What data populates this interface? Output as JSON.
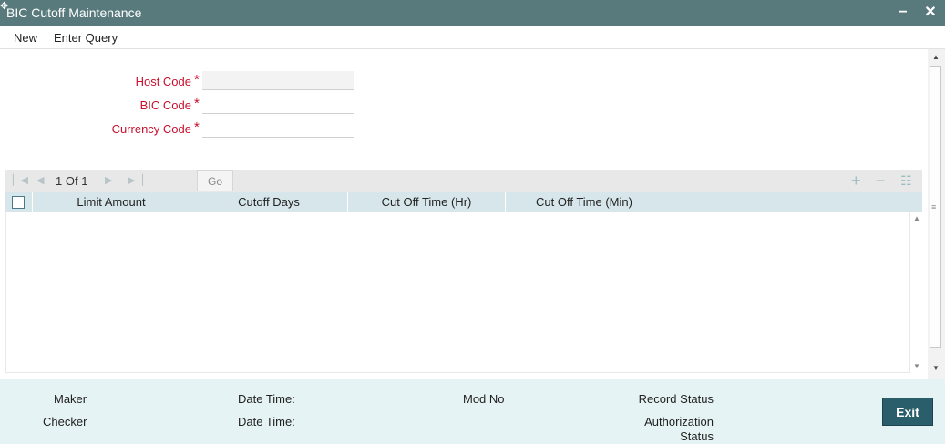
{
  "window": {
    "title": "BIC Cutoff Maintenance",
    "minimize_label": "−",
    "close_label": "✕"
  },
  "menu": {
    "new_label": "New",
    "enter_query_label": "Enter Query"
  },
  "form": {
    "host_code": {
      "label": "Host Code",
      "required_mark": "*",
      "value": ""
    },
    "bic_code": {
      "label": "BIC Code",
      "required_mark": "*",
      "value": ""
    },
    "currency_code": {
      "label": "Currency Code",
      "required_mark": "*",
      "value": ""
    }
  },
  "grid": {
    "pagination": {
      "current": "1",
      "of_label": "Of",
      "total": "1"
    },
    "go_label": "Go",
    "columns": [
      "Limit Amount",
      "Cutoff Days",
      "Cut Off Time (Hr)",
      "Cut Off Time (Min)"
    ],
    "rows": []
  },
  "footer": {
    "maker_label": "Maker",
    "checker_label": "Checker",
    "date_time_label": "Date Time:",
    "mod_no_label": "Mod No",
    "record_status_label": "Record Status",
    "authorization_status_line1": "Authorization",
    "authorization_status_line2": "Status",
    "exit_label": "Exit"
  },
  "icons": {
    "first": "first-page-icon",
    "prev": "previous-page-icon",
    "next": "next-page-icon",
    "last": "last-page-icon",
    "add": "add-row-icon",
    "delete": "delete-row-icon",
    "list": "list-view-icon"
  },
  "colors": {
    "titlebar": "#587a7d",
    "label_red": "#c8102e",
    "grid_header": "#d6e6ea",
    "footer": "#e6f3f4",
    "exit_button": "#2b5e6b"
  }
}
